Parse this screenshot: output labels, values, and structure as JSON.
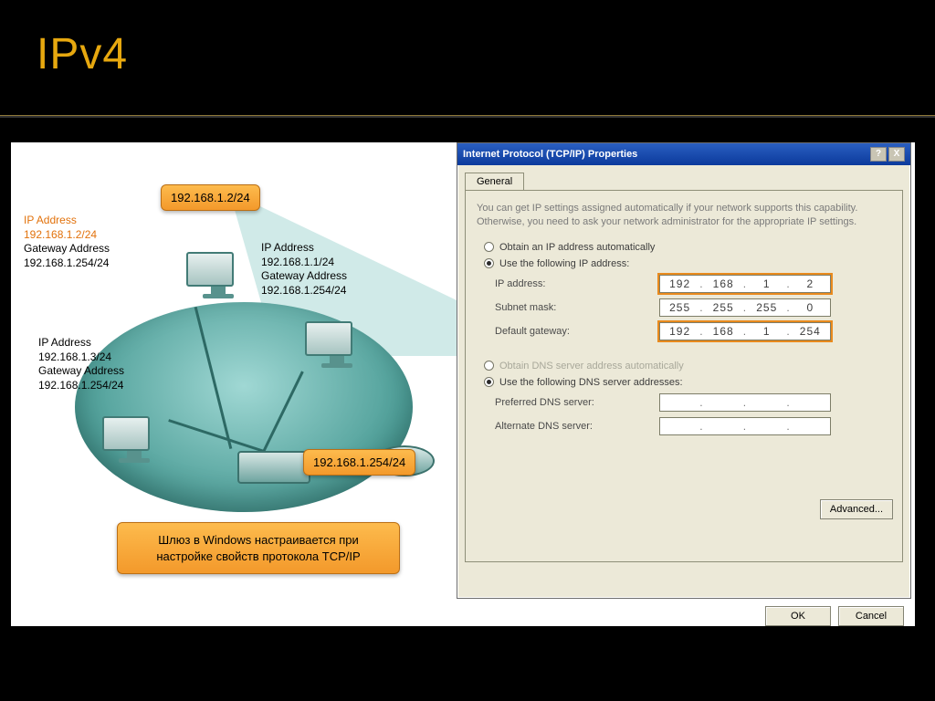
{
  "slide": {
    "title": "IPv4"
  },
  "diagram": {
    "callouts": {
      "pc1_ip": "192.168.1.2/24",
      "router_ip": "192.168.1.254/24"
    },
    "hosts": {
      "left_label_ip_hdr": "IP Address",
      "left_label_ip": "192.168.1.2/24",
      "left_label_gw_hdr": "Gateway Address",
      "left_label_gw": "192.168.1.254/24",
      "bl_ip_hdr": "IP Address",
      "bl_ip": "192.168.1.3/24",
      "bl_gw_hdr": "Gateway Address",
      "bl_gw": "192.168.1.254/24",
      "r_ip_hdr": "IP Address",
      "r_ip": "192.168.1.1/24",
      "r_gw_hdr": "Gateway Address",
      "r_gw": "192.168.1.254/24"
    },
    "note": "Шлюз в Windows настраивается при настройке свойств протокола TCP/IP"
  },
  "dialog": {
    "title": "Internet Protocol (TCP/IP) Properties",
    "tab": "General",
    "description": "You can get IP settings assigned automatically if your network supports this capability. Otherwise, you need to ask your network administrator for the appropriate IP settings.",
    "radio_auto": "Obtain an IP address automatically",
    "radio_manual": "Use the following IP address:",
    "labels": {
      "ip": "IP address:",
      "mask": "Subnet mask:",
      "gw": "Default gateway:"
    },
    "values": {
      "ip": [
        "192",
        "168",
        "1",
        "2"
      ],
      "mask": [
        "255",
        "255",
        "255",
        "0"
      ],
      "gw": [
        "192",
        "168",
        "1",
        "254"
      ]
    },
    "dns_auto": "Obtain DNS server address automatically",
    "dns_manual": "Use the following DNS server addresses:",
    "dns_labels": {
      "pref": "Preferred DNS server:",
      "alt": "Alternate DNS server:"
    },
    "buttons": {
      "advanced": "Advanced...",
      "ok": "OK",
      "cancel": "Cancel"
    },
    "winbtns": {
      "help": "?",
      "close": "X"
    }
  }
}
